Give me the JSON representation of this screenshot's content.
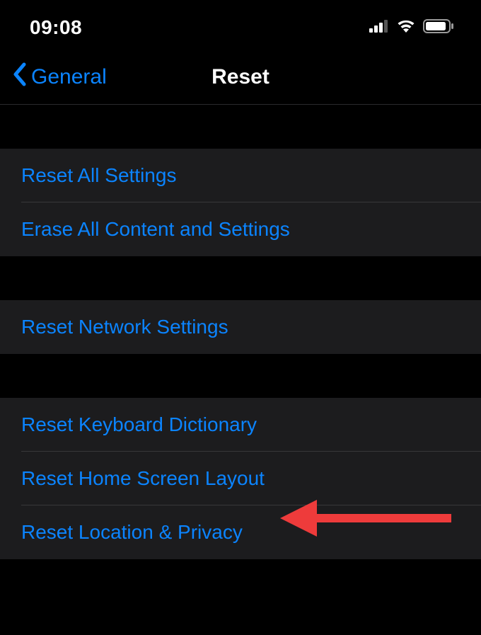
{
  "status_bar": {
    "time": "09:08"
  },
  "nav": {
    "back_label": "General",
    "title": "Reset"
  },
  "groups": [
    {
      "items": [
        {
          "label": "Reset All Settings"
        },
        {
          "label": "Erase All Content and Settings"
        }
      ]
    },
    {
      "items": [
        {
          "label": "Reset Network Settings"
        }
      ]
    },
    {
      "items": [
        {
          "label": "Reset Keyboard Dictionary"
        },
        {
          "label": "Reset Home Screen Layout"
        },
        {
          "label": "Reset Location & Privacy"
        }
      ]
    }
  ]
}
